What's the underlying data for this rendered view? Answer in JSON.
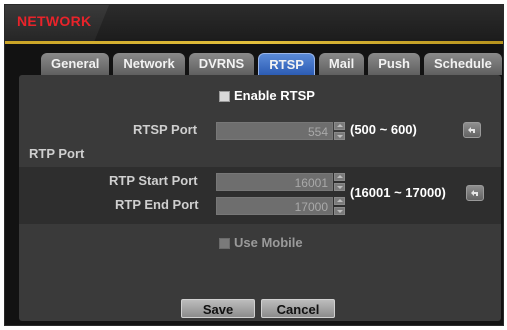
{
  "window": {
    "title": "NETWORK"
  },
  "tabs": [
    {
      "label": "General"
    },
    {
      "label": "Network"
    },
    {
      "label": "DVRNS"
    },
    {
      "label": "RTSP",
      "active": true
    },
    {
      "label": "Mail"
    },
    {
      "label": "Push"
    },
    {
      "label": "Schedule"
    }
  ],
  "rtsp": {
    "enable_label": "Enable RTSP",
    "enable_checked": false,
    "port_label": "RTSP Port",
    "port_value": "554",
    "port_range": "(500 ~ 600)"
  },
  "rtp": {
    "section_label": "RTP Port",
    "start_label": "RTP Start Port",
    "start_value": "16001",
    "end_label": "RTP End Port",
    "end_value": "17000",
    "range": "(16001 ~ 17000)"
  },
  "mobile": {
    "label": "Use Mobile",
    "checked": false
  },
  "footer": {
    "save_label": "Save",
    "cancel_label": "Cancel"
  },
  "colors": {
    "title_text": "#e8232a",
    "accent_line": "#d8b332",
    "active_tab": "#2c5cb4",
    "panel": "#3a3a3a"
  }
}
